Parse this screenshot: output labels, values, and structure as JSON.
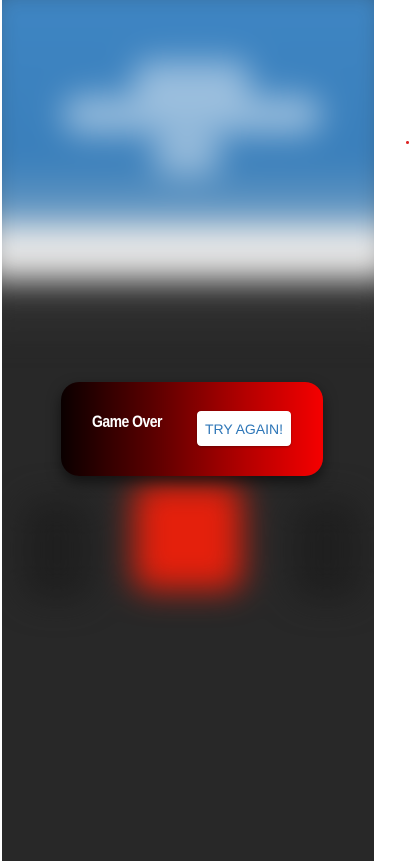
{
  "game_over": {
    "title": "Game Over",
    "button_label": "TRY AGAIN!"
  },
  "colors": {
    "background": "#282828",
    "sky": "#3f86c4",
    "banner_start": "#0a0000",
    "banner_end": "#f50000",
    "button_text": "#2f77b8",
    "player_block": "#e4200c"
  }
}
